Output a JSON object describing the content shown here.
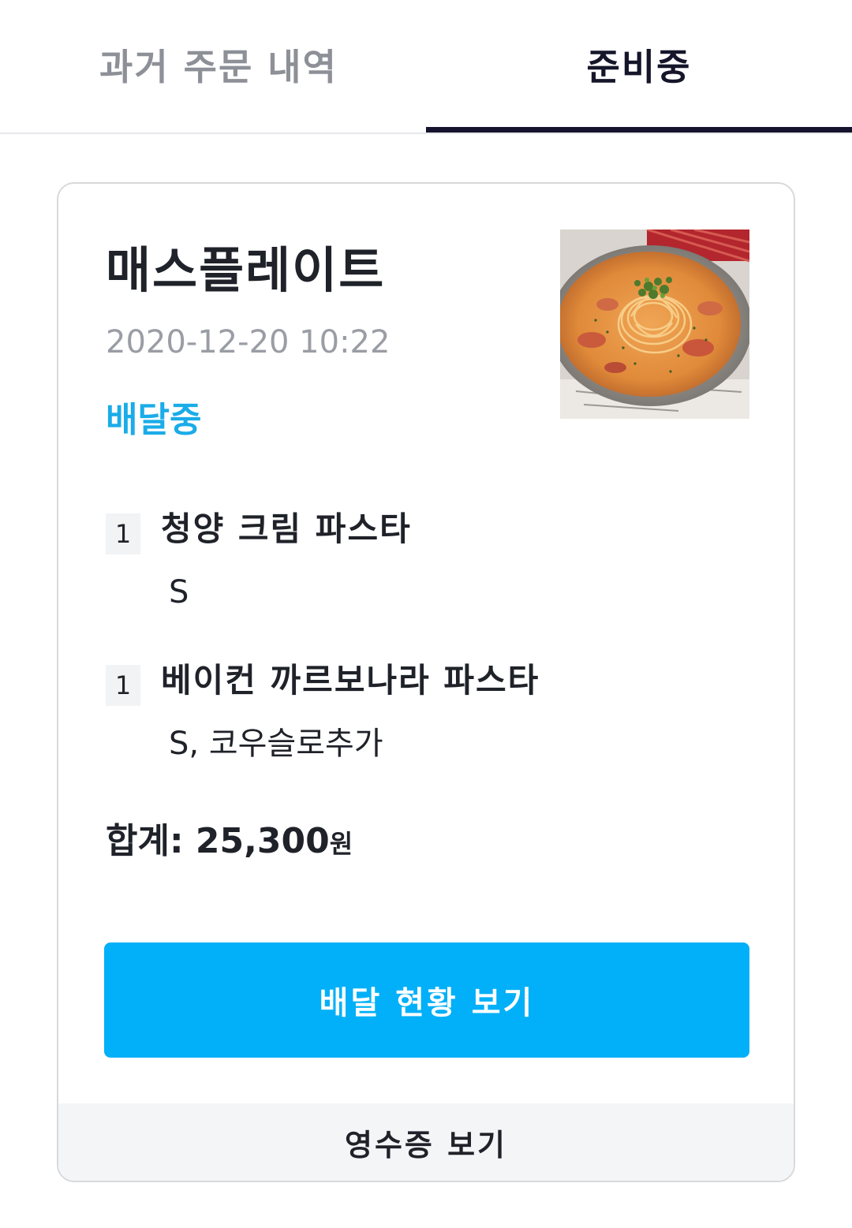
{
  "tabs": {
    "past_orders_label": "과거 주문 내역",
    "preparing_label": "준비중",
    "active_tab": "preparing"
  },
  "order": {
    "store_name": "매스플레이트",
    "datetime": "2020-12-20 10:22",
    "status": "배달중",
    "photo_icon": "pasta-dish-photo",
    "items": [
      {
        "quantity": "1",
        "name": "청양 크림 파스타",
        "options": "S"
      },
      {
        "quantity": "1",
        "name": "베이컨 까르보나라 파스타",
        "options": "S, 코우슬로추가"
      }
    ],
    "total_label": "합계:",
    "total_amount": "25,300",
    "total_currency": "원",
    "track_button_label": "배달 현황 보기",
    "receipt_button_label": "영수증 보기"
  },
  "colors": {
    "accent": "#01b0f8",
    "status": "#1aace8",
    "active_tab_indicator": "#15132e",
    "inactive_tab_text": "#8d9097"
  }
}
